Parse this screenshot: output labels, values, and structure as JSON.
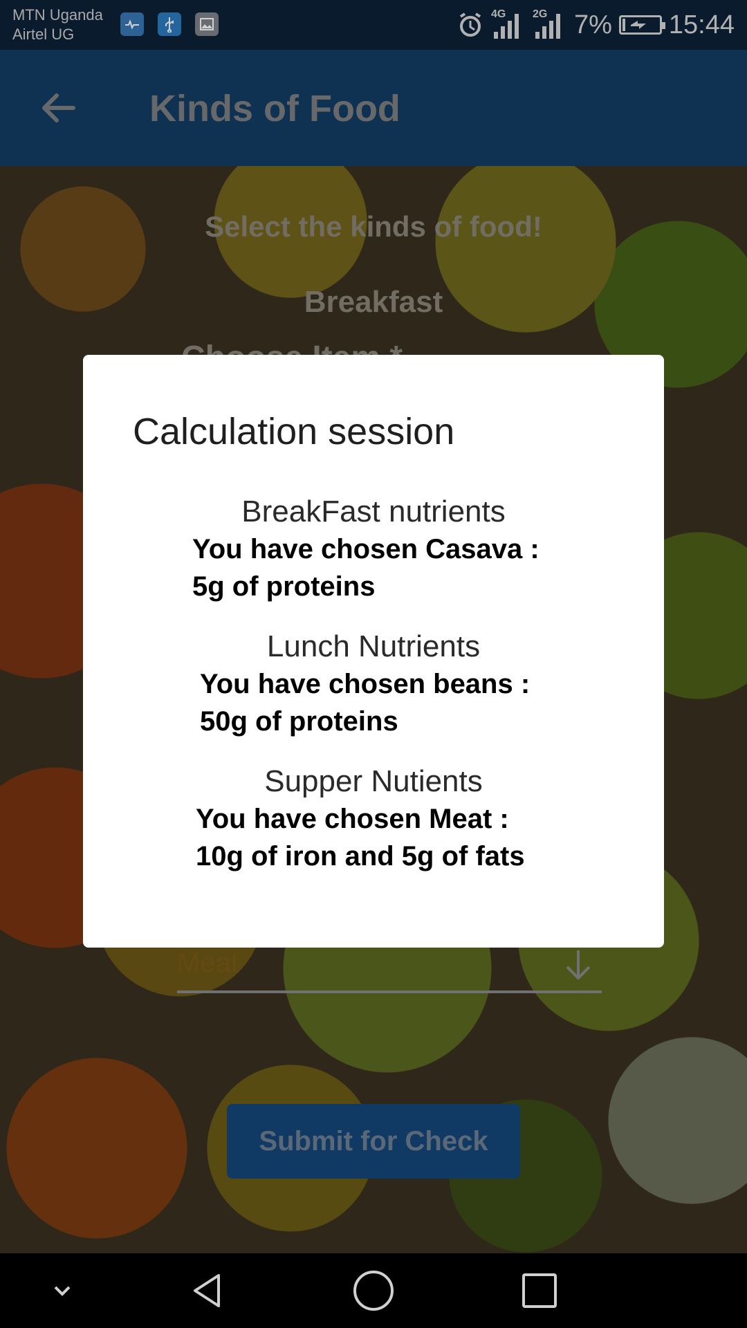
{
  "status_bar": {
    "carrier_1": "MTN Uganda",
    "carrier_2": "Airtel UG",
    "network_1": "4G",
    "network_2": "2G",
    "battery": "7%",
    "battery_level": 0.07,
    "time": "15:44",
    "icons": [
      "health-icon",
      "usb-icon",
      "gallery-icon",
      "alarm-icon",
      "signal-icon",
      "battery-charging-icon"
    ]
  },
  "app_bar": {
    "title": "Kinds of Food",
    "back_icon": "back-arrow-icon"
  },
  "background": {
    "heading": "Select the kinds of food!",
    "section": "Breakfast",
    "choose_label": "Choose Item *",
    "select_value": "Meat",
    "select_icon": "arrow-down-icon",
    "submit_label": "Submit for Check"
  },
  "dialog": {
    "title": "Calculation session",
    "sections": [
      {
        "heading": "BreakFast nutrients",
        "text": "You have chosen Casava :\n5g of proteins"
      },
      {
        "heading": "Lunch Nutrients",
        "text": "You have chosen beans :\n50g of proteins"
      },
      {
        "heading": "Supper Nutients",
        "text": "You have chosen Meat :\n10g of iron and 5g of fats"
      }
    ]
  },
  "nav_bar": {
    "icons": [
      "hide-icon",
      "back-icon",
      "home-icon",
      "recents-icon"
    ]
  },
  "colors": {
    "app_bar": "#133d66",
    "status_bar": "#0b2238",
    "submit_button": "#14477a",
    "dialog": "#ffffff"
  }
}
